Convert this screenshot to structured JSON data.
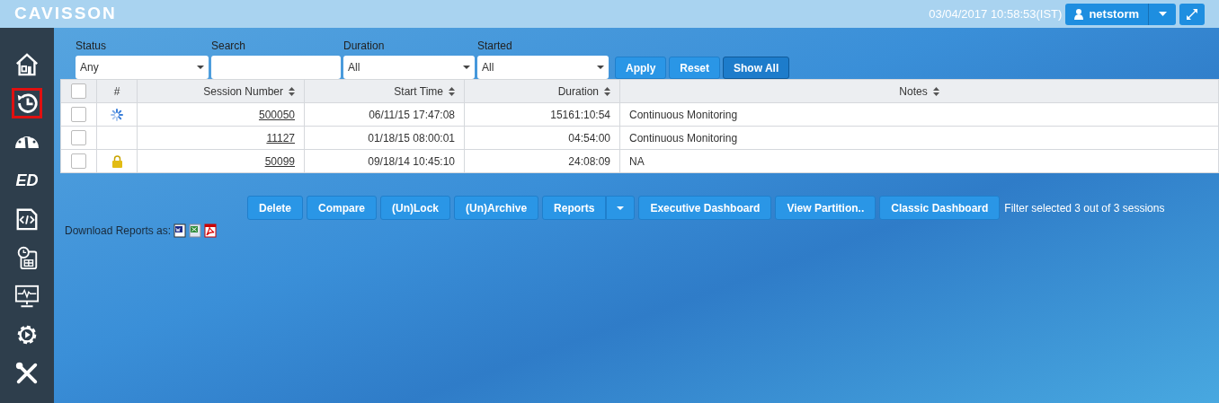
{
  "header": {
    "logo": "CAVISSON",
    "datetime": "03/04/2017 10:58:53(IST)",
    "user": "netstorm"
  },
  "sidebar": {
    "items": [
      {
        "selected": false
      },
      {
        "selected": true
      },
      {
        "selected": false
      },
      {
        "label": "ED",
        "selected": false
      },
      {
        "selected": false
      },
      {
        "selected": false
      },
      {
        "selected": false
      },
      {
        "selected": false
      },
      {
        "selected": false
      }
    ]
  },
  "filters": [
    {
      "label": "Status",
      "kind": "select",
      "value": "Any"
    },
    {
      "label": "Search",
      "kind": "text"
    },
    {
      "label": "Duration",
      "kind": "select",
      "value": "All"
    },
    {
      "label": "Started",
      "kind": "select",
      "value": "All"
    }
  ],
  "filter_buttons": [
    {
      "label": "Apply",
      "kind": "normal"
    },
    {
      "label": "Reset",
      "kind": "normal"
    },
    {
      "label": "Show All",
      "kind": "dark"
    }
  ],
  "table": {
    "header_checked": false,
    "columns": [
      "#",
      "Session Number",
      "Start Time",
      "Duration",
      "Notes"
    ],
    "rows": [
      {
        "checked": false,
        "running": true,
        "locked": false,
        "session": "500050",
        "start": "06/11/15 17:47:08",
        "duration": "15161:10:54",
        "notes": "Continuous Monitoring"
      },
      {
        "checked": false,
        "running": false,
        "locked": false,
        "session": "11127",
        "start": "01/18/15 08:00:01",
        "duration": "04:54:00",
        "notes": "Continuous Monitoring"
      },
      {
        "checked": false,
        "running": false,
        "locked": true,
        "session": "50099",
        "start": "09/18/14 10:45:10",
        "duration": "24:08:09",
        "notes": "NA"
      }
    ]
  },
  "actions": [
    {
      "label": "Delete",
      "kind": "button"
    },
    {
      "label": "Compare",
      "kind": "button"
    },
    {
      "label": "(Un)Lock",
      "kind": "button"
    },
    {
      "label": "(Un)Archive",
      "kind": "button"
    },
    {
      "label": "Reports",
      "kind": "split"
    },
    {
      "label": "Executive Dashboard",
      "kind": "button"
    },
    {
      "label": "View Partition..",
      "kind": "button"
    },
    {
      "label": "Classic Dashboard",
      "kind": "button"
    }
  ],
  "filter_summary": "Filter selected 3 out of 3 sessions",
  "download": {
    "label": "Download Reports as:"
  }
}
